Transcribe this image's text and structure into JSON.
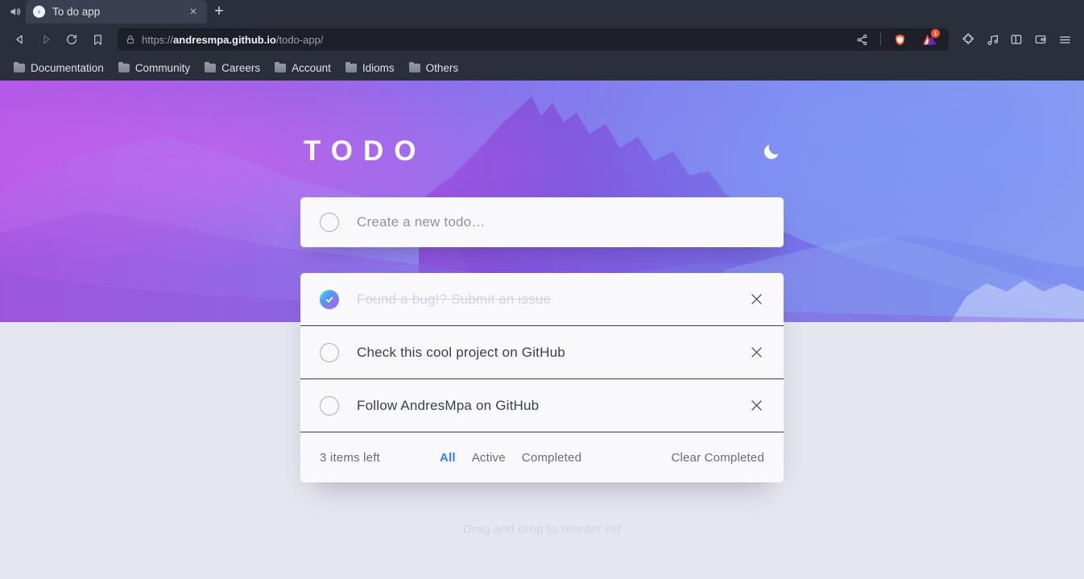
{
  "browser": {
    "audio_icon": "speaker-icon",
    "tab": {
      "title": "To do app",
      "favicon": "site-favicon",
      "close_label": "×"
    },
    "new_tab_label": "+",
    "nav": {
      "back": "back-arrow-icon",
      "forward": "forward-arrow-icon",
      "reload": "reload-icon",
      "bookmark": "bookmark-icon"
    },
    "url": {
      "lock_icon": "lock-icon",
      "scheme": "https://",
      "domain": "andresmpa.github.io",
      "path": "/todo-app/"
    },
    "actions": [
      {
        "name": "share-icon",
        "label": "share"
      },
      {
        "name": "brave-shields-icon",
        "label": "shields"
      },
      {
        "name": "brave-rewards-icon",
        "label": "rewards",
        "badge": "1"
      },
      {
        "name": "extensions-puzzle-icon",
        "label": "extensions"
      },
      {
        "name": "music-note-icon",
        "label": "media"
      },
      {
        "name": "sidebar-panel-icon",
        "label": "sidebar"
      },
      {
        "name": "wallet-icon",
        "label": "wallet"
      },
      {
        "name": "hamburger-menu-icon",
        "label": "menu"
      }
    ],
    "bookmarks": [
      {
        "label": "Documentation"
      },
      {
        "label": "Community"
      },
      {
        "label": "Careers"
      },
      {
        "label": "Account"
      },
      {
        "label": "Idioms"
      },
      {
        "label": "Others"
      }
    ]
  },
  "app": {
    "title": "TODO",
    "theme_toggle_icon": "moon-icon",
    "create": {
      "placeholder": "Create a new todo…",
      "value": ""
    },
    "todos": [
      {
        "label": "Found a bug!? Submit an issue",
        "completed": true
      },
      {
        "label": "Check this cool project on GitHub",
        "completed": false
      },
      {
        "label": "Follow AndresMpa on GitHub",
        "completed": false
      }
    ],
    "footer": {
      "items_left": "3 items left",
      "filters": [
        {
          "label": "All",
          "active": true
        },
        {
          "label": "Active",
          "active": false
        },
        {
          "label": "Completed",
          "active": false
        }
      ],
      "clear_label": "Clear Completed"
    },
    "hint": "Drag and drop to reorder list"
  },
  "colors": {
    "accent_blue": "#3a7bfd",
    "check_gradient_start": "#57ddff",
    "check_gradient_end": "#c058f3",
    "hero_left": "#b258e8",
    "hero_right": "#8b9cf2",
    "page_bg": "#e6e6ef",
    "card_bg": "#f9f9fb"
  }
}
